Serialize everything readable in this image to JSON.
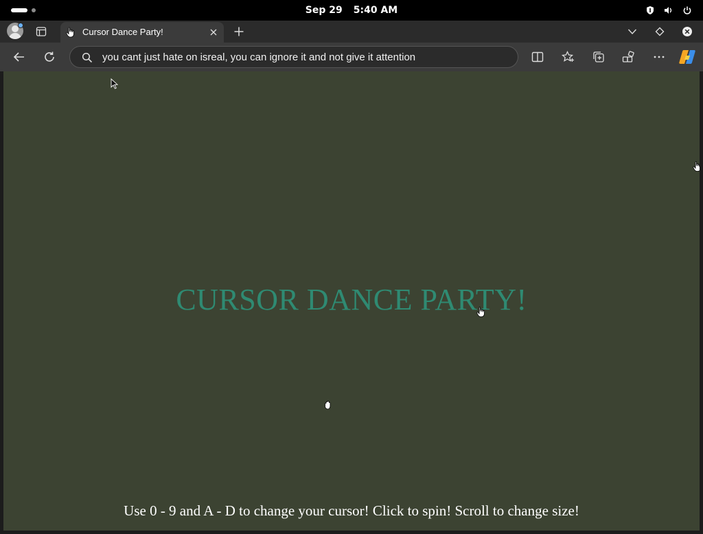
{
  "system_bar": {
    "date": "Sep 29",
    "time": "5:40 AM",
    "icons": [
      "activities-pill-icon",
      "workspace-dot-icon",
      "shield-icon",
      "volume-icon",
      "power-icon"
    ]
  },
  "browser": {
    "tab": {
      "title": "Cursor Dance Party!",
      "favicon": "hand-cursor-icon"
    },
    "address_bar": {
      "value": "you cant just hate on isreal, you can ignore it and not give it attention"
    },
    "toolbar_icons": [
      "back-icon",
      "refresh-icon",
      "search-icon",
      "split-screen-icon",
      "favorites-icon",
      "collections-icon",
      "extensions-icon",
      "more-icon",
      "copilot-icon"
    ],
    "tabstrip_icons": [
      "profile-icon",
      "tab-actions-icon",
      "close-tab-icon",
      "new-tab-icon",
      "tab-list-icon",
      "diamond-icon",
      "close-window-icon"
    ]
  },
  "page": {
    "title": "CURSOR DANCE PARTY!",
    "instructions": "Use 0 - 9 and A - D to change your cursor! Click to spin! Scroll to change size!",
    "colors": {
      "background": "#3c4332",
      "title": "#2f8a72",
      "instructions": "#ffffff"
    },
    "cursors": [
      "arrow-cursor-icon",
      "pointing-hand-cursor-icon",
      "pointing-hand-cursor-icon",
      "open-hand-cursor-icon"
    ]
  }
}
